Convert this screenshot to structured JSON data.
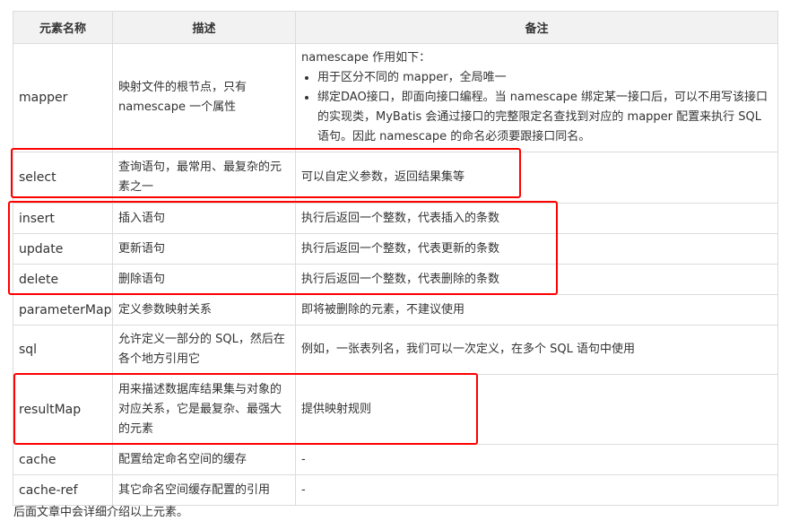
{
  "headers": [
    "元素名称",
    "描述",
    "备注"
  ],
  "mapper": {
    "name": "mapper",
    "desc": "映射文件的根节点，只有 namescape 一个属性",
    "note_intro": "namescape 作用如下：",
    "note_items": [
      "用于区分不同的 mapper，全局唯一",
      "绑定DAO接口，即面向接口编程。当 namescape 绑定某一接口后，可以不用写该接口的实现类，MyBatis 会通过接口的完整限定名查找到对应的 mapper 配置来执行 SQL 语句。因此 namescape 的命名必须要跟接口同名。"
    ]
  },
  "rows": [
    {
      "name": "select",
      "desc": "查询语句，最常用、最复杂的元素之一",
      "note": "可以自定义参数，返回结果集等"
    },
    {
      "name": "insert",
      "desc": "插入语句",
      "note": "执行后返回一个整数，代表插入的条数"
    },
    {
      "name": "update",
      "desc": "更新语句",
      "note": "执行后返回一个整数，代表更新的条数"
    },
    {
      "name": "delete",
      "desc": "删除语句",
      "note": "执行后返回一个整数，代表删除的条数"
    },
    {
      "name": "parameterMap",
      "desc": "定义参数映射关系",
      "note": "即将被删除的元素，不建议使用"
    },
    {
      "name": "sql",
      "desc": "允许定义一部分的 SQL，然后在各个地方引用它",
      "note": "例如，一张表列名，我们可以一次定义，在多个 SQL 语句中使用"
    },
    {
      "name": "resultMap",
      "desc": "用来描述数据库结果集与对象的对应关系，它是最复杂、最强大的元素",
      "note": "提供映射规则"
    },
    {
      "name": "cache",
      "desc": "配置给定命名空间的缓存",
      "note": "-"
    },
    {
      "name": "cache-ref",
      "desc": "其它命名空间缓存配置的引用",
      "note": "-"
    }
  ],
  "footer": "后面文章中会详细介绍以上元素。",
  "highlight_color": "#ff0000"
}
